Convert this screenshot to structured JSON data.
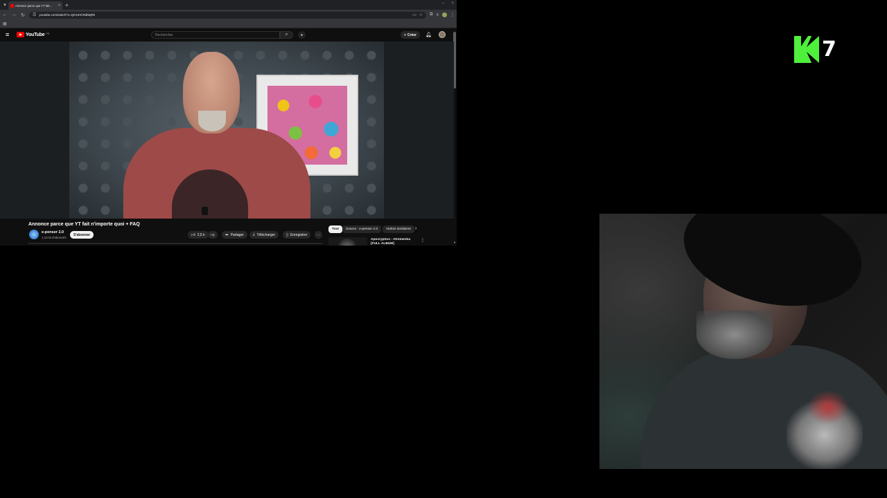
{
  "browser": {
    "tab_title": "Annonce parce que YT fait...",
    "url": "youtube.com/watch?v=QmUHCRdMqRk"
  },
  "youtube": {
    "logo_text": "YouTube",
    "logo_country": "FR",
    "search_placeholder": "Rechercher",
    "create_label": "Créer",
    "video_title": "Annonce parce que YT fait n'importe quoi + FAQ",
    "channel_name": "e-penser 2.0",
    "subscribers": "1,13 M d'abonnés",
    "subscribe_label": "S'abonner",
    "likes": "2,5 k",
    "share_label": "Partager",
    "download_label": "Télécharger",
    "save_label": "Enregistrer",
    "chips": [
      "Tout",
      "Source : e-penser 2.0",
      "Vidéos similaires"
    ],
    "recommended_title": "Apocryphos - Atrementia [FULL ALBUM]"
  },
  "overlay": {
    "logo_number": "7"
  },
  "colors": {
    "accent_red": "#ff0000",
    "logo_green": "#4ef03b"
  }
}
